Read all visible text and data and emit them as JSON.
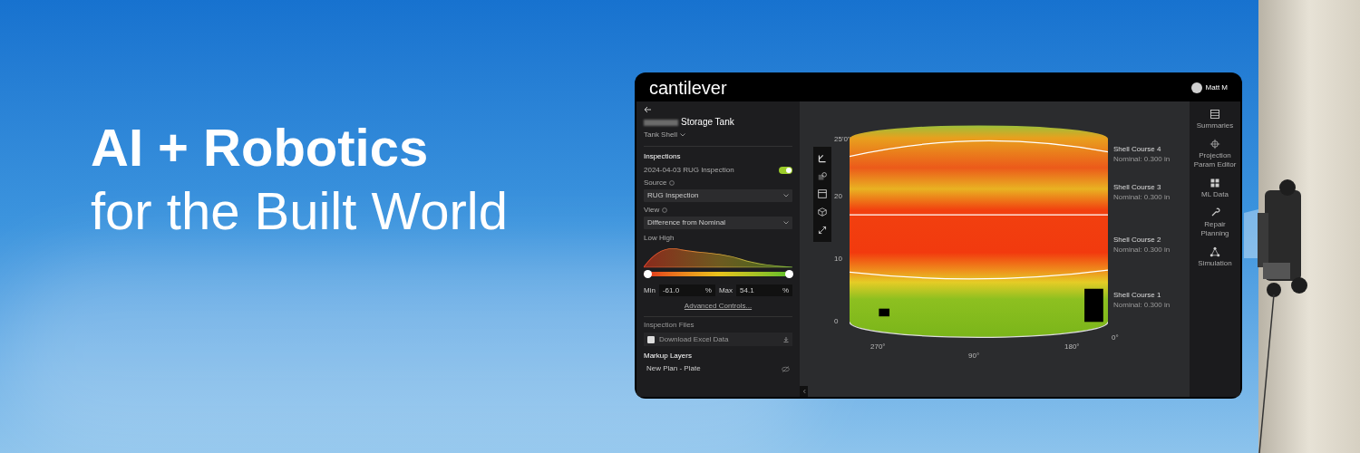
{
  "hero": {
    "title": "AI + Robotics",
    "subtitle": "for the Built World"
  },
  "app": {
    "logo": "cantilever",
    "user": {
      "name": "Matt M"
    },
    "panel": {
      "asset_title": "Storage Tank",
      "component": "Tank Shell",
      "inspections_heading": "Inspections",
      "inspection": {
        "label": "2024-04-03 RUG Inspection",
        "on": true
      },
      "source": {
        "label": "Source",
        "value": "RUG Inspection"
      },
      "view": {
        "label": "View",
        "value": "Difference from Nominal"
      },
      "histogram_label": "Low High",
      "slider": {
        "min_handle": {
          "level": 0
        },
        "max_handle": {
          "level": 1
        }
      },
      "range": {
        "min_label": "Min",
        "min": "-61.0",
        "min_unit": "%",
        "max_label": "Max",
        "max": "54.1",
        "max_unit": "%"
      },
      "advanced_link": "Advanced Controls...",
      "files_heading": "Inspection Files",
      "file": "Download Excel Data",
      "markup_heading": "Markup Layers",
      "layers": [
        {
          "name": "New Plan - Plate",
          "visible": false
        }
      ]
    },
    "viewer": {
      "y_ticks": [
        "25'0\"",
        "20",
        "10",
        "0"
      ],
      "x_ticks": [
        "270°",
        "90°",
        "180°",
        "0°"
      ],
      "courses": [
        {
          "name": "Shell Course 4",
          "nominal": "Nominal: 0.300 in"
        },
        {
          "name": "Shell Course 3",
          "nominal": "Nominal: 0.300 in"
        },
        {
          "name": "Shell Course 2",
          "nominal": "Nominal: 0.300 in"
        },
        {
          "name": "Shell Course 1",
          "nominal": "Nominal: 0.300 in"
        }
      ]
    },
    "sidebar": [
      {
        "kind": "summary",
        "label": "Summaries"
      },
      {
        "kind": "projection",
        "label": "Projection Param Editor"
      },
      {
        "kind": "grid",
        "label": "ML Data"
      },
      {
        "kind": "wrench",
        "label": "Repair Planning"
      },
      {
        "kind": "network",
        "label": "Simulation"
      }
    ]
  }
}
